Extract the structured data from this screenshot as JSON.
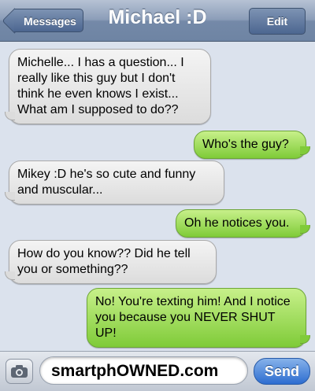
{
  "header": {
    "back_label": "Messages",
    "title": "Michael :D",
    "edit_label": "Edit"
  },
  "messages": [
    {
      "from": "received",
      "text": "Michelle... I has a question... I really like this guy but I don't think he even knows I exist... What am I supposed to do??"
    },
    {
      "from": "sent",
      "text": "Who's the guy?"
    },
    {
      "from": "received",
      "text": "Mikey :D he's so cute and funny and muscular..."
    },
    {
      "from": "sent",
      "text": "Oh he notices you."
    },
    {
      "from": "received",
      "text": "How do you know?? Did he tell you or something??"
    },
    {
      "from": "sent",
      "text": "No! You're texting him! And I notice you because you NEVER SHUT UP!"
    }
  ],
  "footer": {
    "camera_icon": "camera-icon",
    "input_value": "smartphOWNED.com",
    "send_label": "Send"
  },
  "colors": {
    "sent_bubble": "#8fd14f",
    "received_bubble": "#e6e6e6",
    "header": "#7489a8",
    "send_button": "#2d6dd0"
  }
}
